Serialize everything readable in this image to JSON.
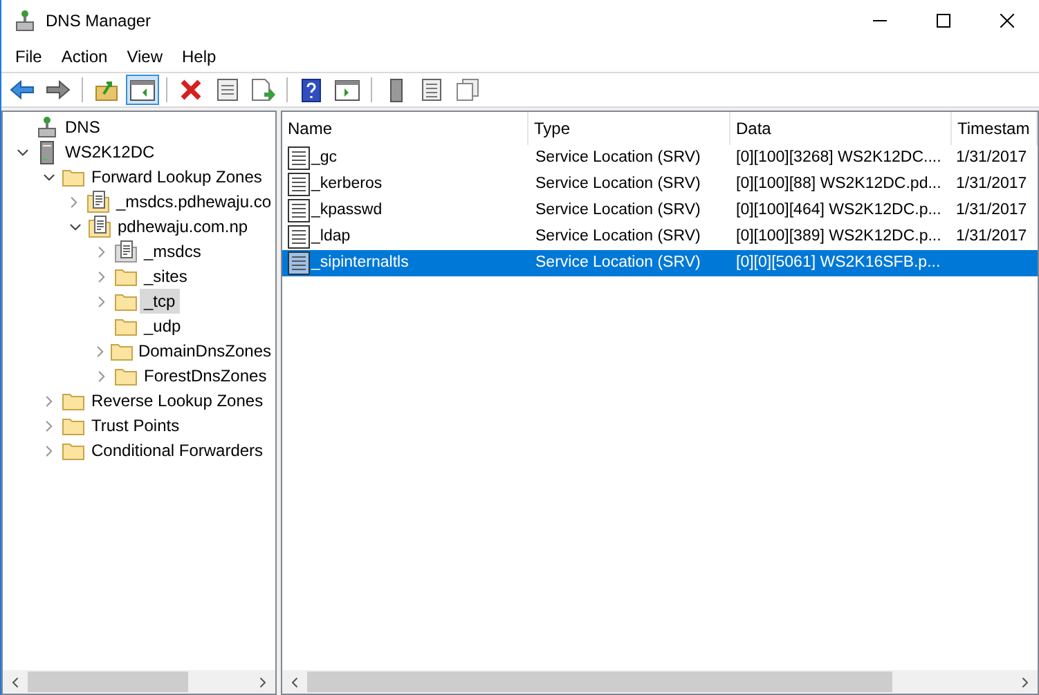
{
  "window": {
    "title": "DNS Manager"
  },
  "menu": [
    "File",
    "Action",
    "View",
    "Help"
  ],
  "toolbar": [
    [
      {
        "kind": "back",
        "pressed": false
      },
      {
        "kind": "forward",
        "pressed": false
      }
    ],
    [
      {
        "kind": "up",
        "pressed": false
      },
      {
        "kind": "tree",
        "pressed": true
      }
    ],
    [
      {
        "kind": "delete",
        "pressed": false
      },
      {
        "kind": "properties",
        "pressed": false
      },
      {
        "kind": "export",
        "pressed": false
      }
    ],
    [
      {
        "kind": "help",
        "pressed": false
      },
      {
        "kind": "pane",
        "pressed": false
      }
    ],
    [
      {
        "kind": "server",
        "pressed": false
      },
      {
        "kind": "list",
        "pressed": false
      },
      {
        "kind": "copy",
        "pressed": false
      }
    ]
  ],
  "tree": [
    {
      "label": "DNS",
      "kind": "dns",
      "selected": false,
      "children": [
        {
          "label": "WS2K12DC",
          "kind": "server",
          "expandable": true,
          "expanded": true,
          "selected": false,
          "children": [
            {
              "label": "Forward Lookup Zones",
              "kind": "folder",
              "expandable": true,
              "expanded": true,
              "selected": false,
              "children": [
                {
                  "label": "_msdcs.pdhewaju.co",
                  "kind": "zone",
                  "expandable": true,
                  "expanded": false,
                  "selected": false
                },
                {
                  "label": "pdhewaju.com.np",
                  "kind": "zone",
                  "expandable": true,
                  "expanded": true,
                  "selected": false,
                  "children": [
                    {
                      "label": "_msdcs",
                      "kind": "zone-grey",
                      "expandable": true,
                      "expanded": false,
                      "selected": false
                    },
                    {
                      "label": "_sites",
                      "kind": "folder",
                      "expandable": true,
                      "expanded": false,
                      "selected": false
                    },
                    {
                      "label": "_tcp",
                      "kind": "folder",
                      "expandable": true,
                      "expanded": false,
                      "selected": true
                    },
                    {
                      "label": "_udp",
                      "kind": "folder",
                      "expandable": false,
                      "selected": false
                    },
                    {
                      "label": "DomainDnsZones",
                      "kind": "folder",
                      "expandable": true,
                      "expanded": false,
                      "selected": false
                    },
                    {
                      "label": "ForestDnsZones",
                      "kind": "folder",
                      "expandable": true,
                      "expanded": false,
                      "selected": false
                    }
                  ]
                }
              ]
            },
            {
              "label": "Reverse Lookup Zones",
              "kind": "folder",
              "expandable": true,
              "expanded": false,
              "selected": false
            },
            {
              "label": "Trust Points",
              "kind": "folder",
              "expandable": true,
              "expanded": false,
              "selected": false
            },
            {
              "label": "Conditional Forwarders",
              "kind": "folder",
              "expandable": true,
              "expanded": false,
              "selected": false
            }
          ]
        }
      ]
    }
  ],
  "table": {
    "columns": [
      "Name",
      "Type",
      "Data",
      "Timestam"
    ],
    "rows": [
      {
        "name": "_gc",
        "type": "Service Location (SRV)",
        "data": "[0][100][3268] WS2K12DC....",
        "timestamp": "1/31/2017",
        "selected": false
      },
      {
        "name": "_kerberos",
        "type": "Service Location (SRV)",
        "data": "[0][100][88] WS2K12DC.pd...",
        "timestamp": "1/31/2017",
        "selected": false
      },
      {
        "name": "_kpasswd",
        "type": "Service Location (SRV)",
        "data": "[0][100][464] WS2K12DC.p...",
        "timestamp": "1/31/2017",
        "selected": false
      },
      {
        "name": "_ldap",
        "type": "Service Location (SRV)",
        "data": "[0][100][389] WS2K12DC.p...",
        "timestamp": "1/31/2017",
        "selected": false
      },
      {
        "name": "_sipinternaltls",
        "type": "Service Location (SRV)",
        "data": "[0][0][5061] WS2K16SFB.p...",
        "selected": true
      }
    ]
  }
}
